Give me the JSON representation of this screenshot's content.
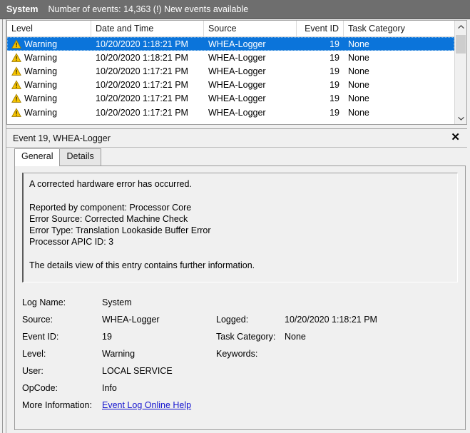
{
  "window": {
    "log_name": "System",
    "log_summary": "Number of events: 14,363 (!) New events available",
    "header_bg": "#6e6e6e"
  },
  "event_list": {
    "columns": [
      {
        "label": "Level",
        "key": "level"
      },
      {
        "label": "Date and Time",
        "key": "datetime"
      },
      {
        "label": "Source",
        "key": "source"
      },
      {
        "label": "Event ID",
        "key": "event_id"
      },
      {
        "label": "Task Category",
        "key": "task_category"
      }
    ],
    "selection_color": "#0b74da",
    "warning_icon": "warning-triangle-icon",
    "rows": [
      {
        "level": "Warning",
        "datetime": "10/20/2020 1:18:21 PM",
        "source": "WHEA-Logger",
        "event_id": "19",
        "task_category": "None",
        "selected": true
      },
      {
        "level": "Warning",
        "datetime": "10/20/2020 1:18:21 PM",
        "source": "WHEA-Logger",
        "event_id": "19",
        "task_category": "None",
        "selected": false
      },
      {
        "level": "Warning",
        "datetime": "10/20/2020 1:17:21 PM",
        "source": "WHEA-Logger",
        "event_id": "19",
        "task_category": "None",
        "selected": false
      },
      {
        "level": "Warning",
        "datetime": "10/20/2020 1:17:21 PM",
        "source": "WHEA-Logger",
        "event_id": "19",
        "task_category": "None",
        "selected": false
      },
      {
        "level": "Warning",
        "datetime": "10/20/2020 1:17:21 PM",
        "source": "WHEA-Logger",
        "event_id": "19",
        "task_category": "None",
        "selected": false
      },
      {
        "level": "Warning",
        "datetime": "10/20/2020 1:17:21 PM",
        "source": "WHEA-Logger",
        "event_id": "19",
        "task_category": "None",
        "selected": false
      }
    ],
    "scrollbar": {
      "up_icon": "chevron-up-icon",
      "down_icon": "chevron-down-icon"
    }
  },
  "detail": {
    "title": "Event 19, WHEA-Logger",
    "close_icon": "close-icon",
    "close_label": "✕",
    "tabs": [
      {
        "label": "General",
        "active": true
      },
      {
        "label": "Details",
        "active": false
      }
    ],
    "description": "A corrected hardware error has occurred.\n\nReported by component: Processor Core\nError Source: Corrected Machine Check\nError Type: Translation Lookaside Buffer Error\nProcessor APIC ID: 3\n\nThe details view of this entry contains further information.",
    "fields": {
      "log_name_label": "Log Name:",
      "log_name_value": "System",
      "source_label": "Source:",
      "source_value": "WHEA-Logger",
      "logged_label": "Logged:",
      "logged_value": "10/20/2020 1:18:21 PM",
      "event_id_label": "Event ID:",
      "event_id_value": "19",
      "task_category_label": "Task Category:",
      "task_category_value": "None",
      "level_label": "Level:",
      "level_value": "Warning",
      "keywords_label": "Keywords:",
      "keywords_value": "",
      "user_label": "User:",
      "user_value": "LOCAL SERVICE",
      "opcode_label": "OpCode:",
      "opcode_value": "Info",
      "more_info_label": "More Information:",
      "more_info_link": "Event Log Online Help",
      "link_color": "#1414cf"
    }
  }
}
